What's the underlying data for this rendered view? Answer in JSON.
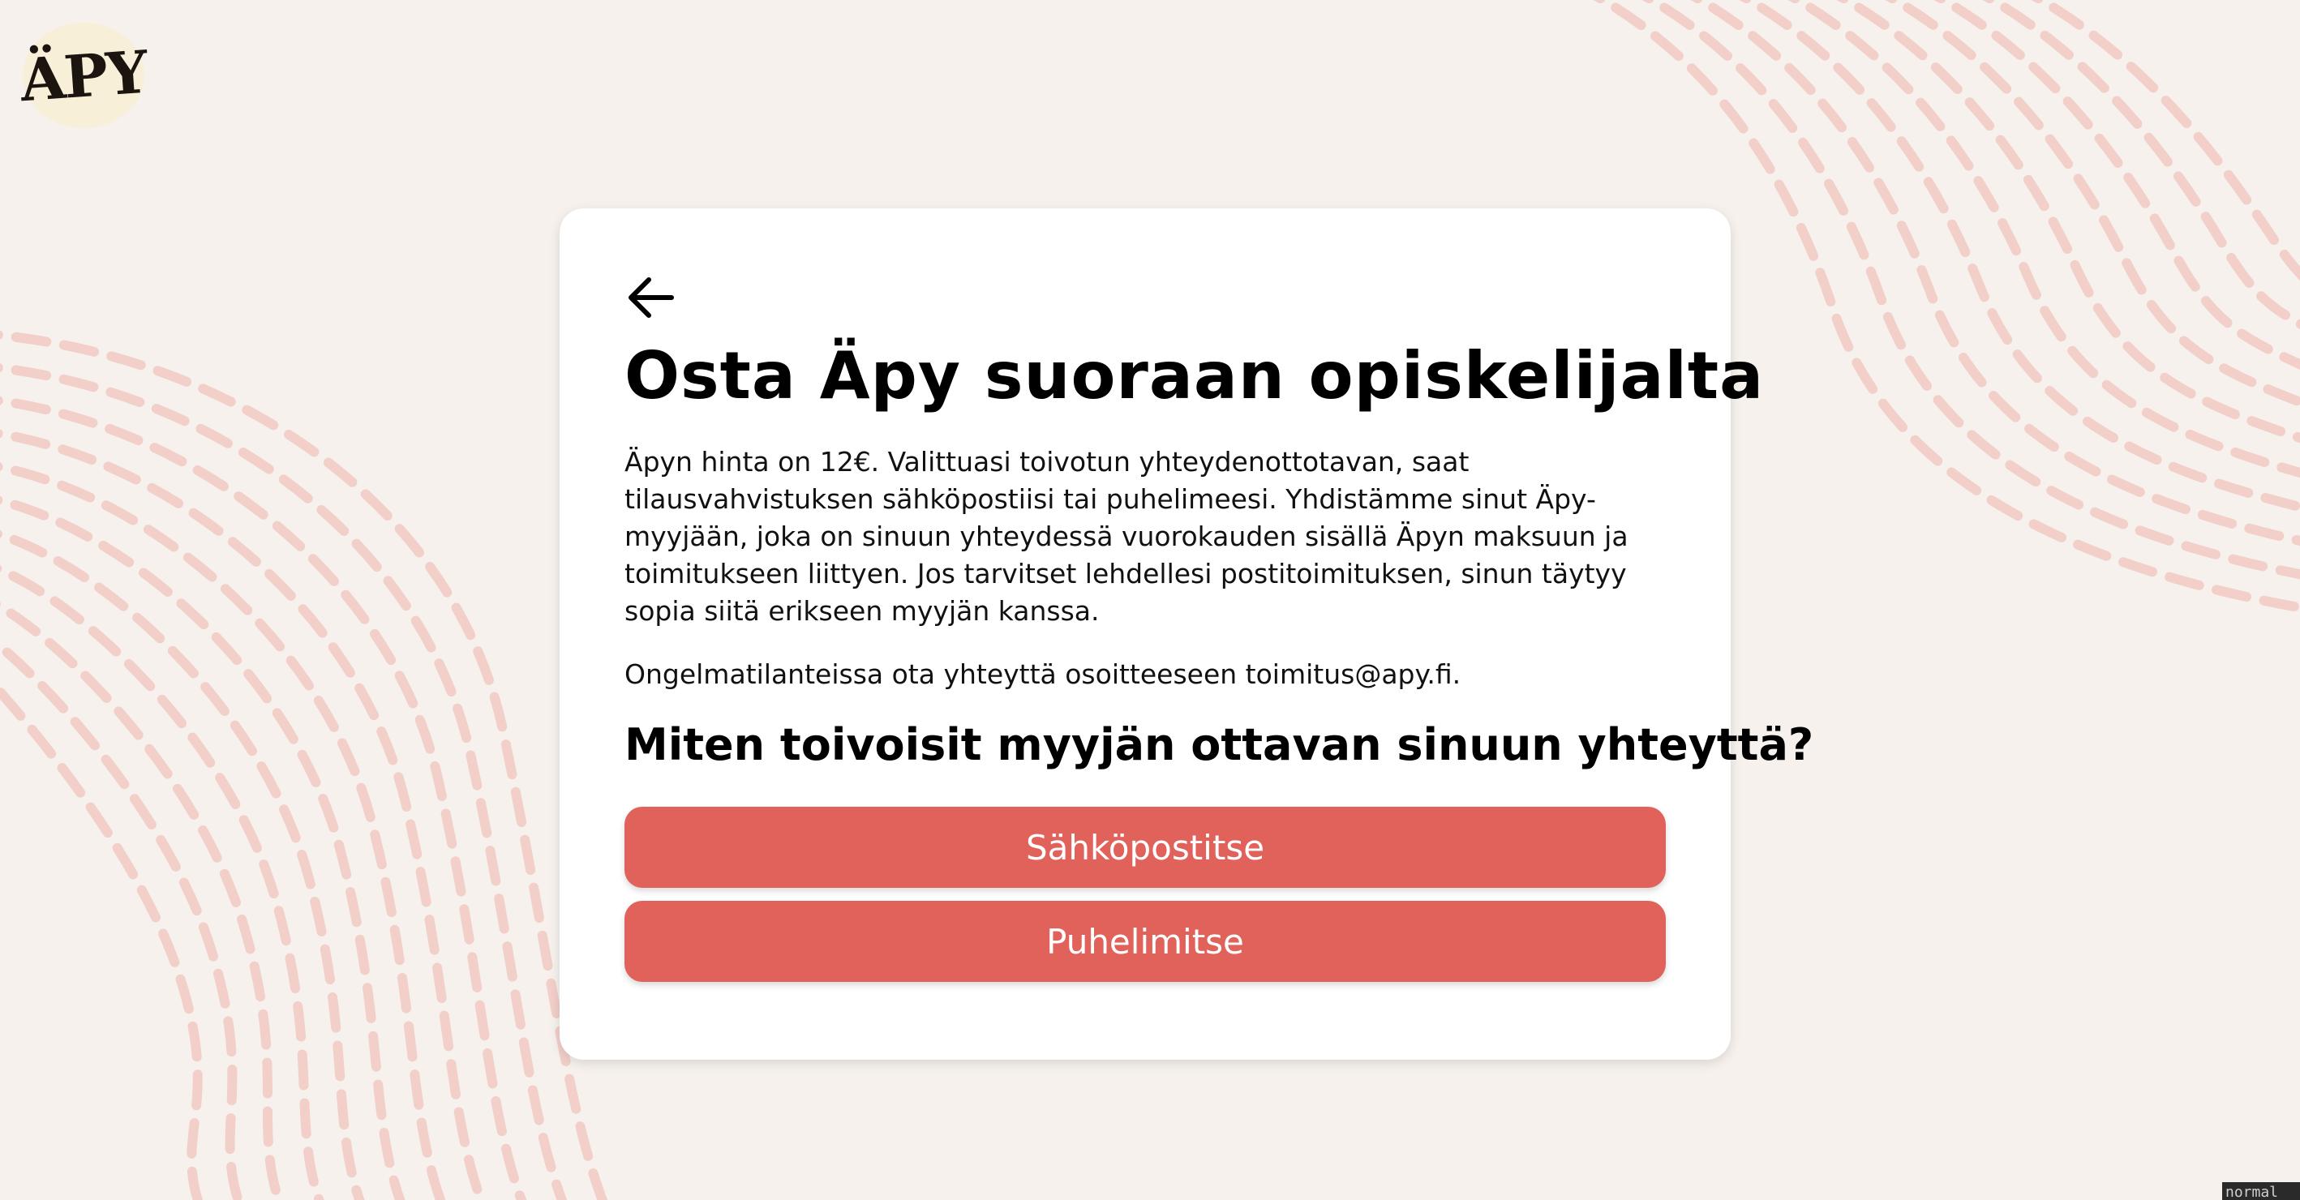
{
  "brand": {
    "logo_text": "ÄPY",
    "accent_color": "#e0625b",
    "pattern_color": "#f2cfc9",
    "background_color": "#f6f1ec"
  },
  "card": {
    "back_icon": "arrow-left-icon",
    "title": "Osta Äpy suoraan opiskelijalta",
    "intro": "Äpyn hinta on 12€. Valittuasi toivotun yhteydenottotavan, saat tilausvahvistuksen sähköpostiisi tai puhelimeesi. Yhdistämme sinut Äpy-myyjään, joka on sinuun yhteydessä vuorokauden sisällä Äpyn maksuun ja toimitukseen liittyen. Jos tarvitset lehdellesi postitoimituksen, sinun täytyy sopia siitä erikseen myyjän kanssa.",
    "contact_note": "Ongelmatilanteissa ota yhteyttä osoitteeseen toimitus@apy.fi.",
    "question": "Miten toivoisit myyjän ottavan sinuun yhteyttä?",
    "options": [
      {
        "label": "Sähköpostitse"
      },
      {
        "label": "Puhelimitse"
      }
    ]
  },
  "status": {
    "mode": "normal"
  }
}
